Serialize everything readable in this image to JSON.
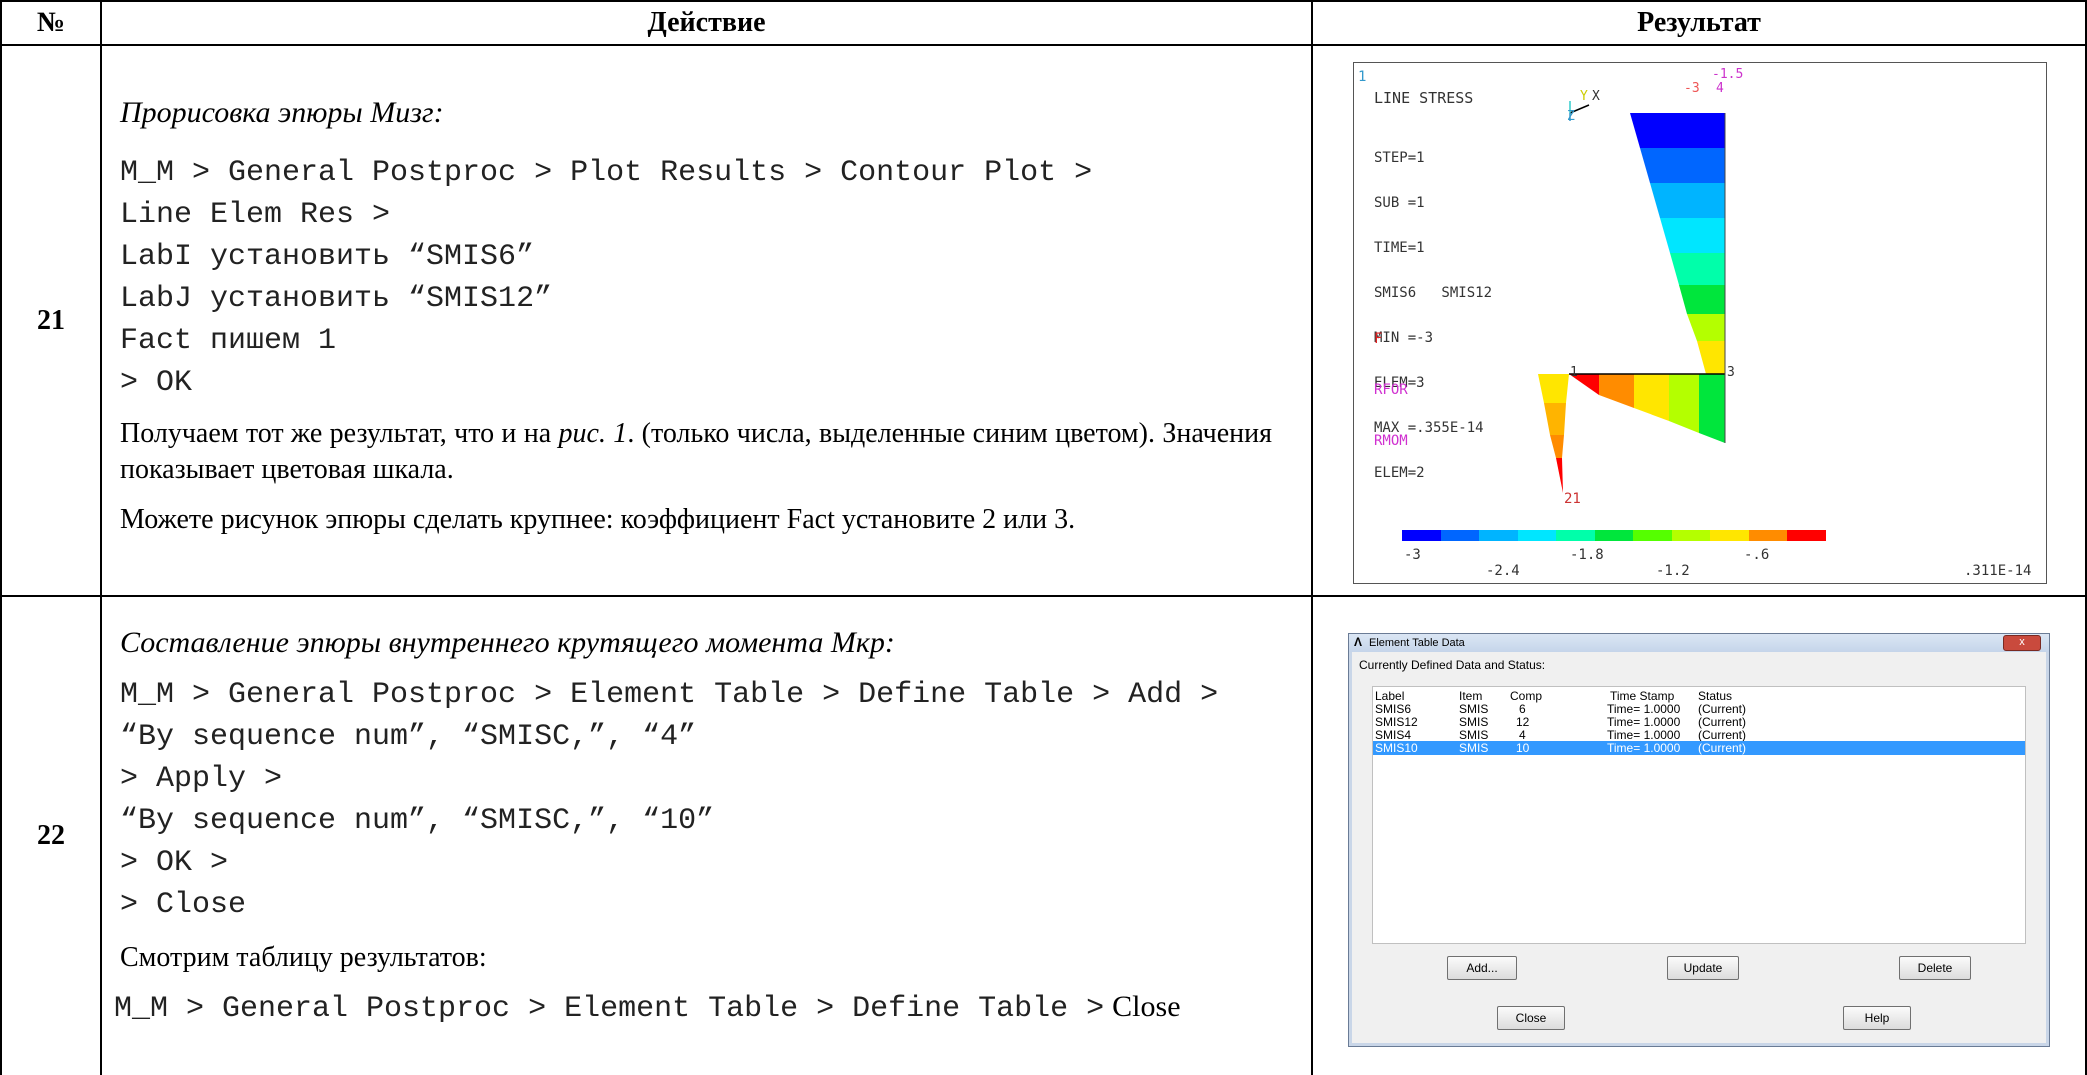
{
  "header": {
    "num": "№",
    "action": "Действие",
    "result": "Результат"
  },
  "row21": {
    "num": "21",
    "title": "Прорисовка эпюры Мизг:",
    "code": [
      "M_M > General Postproc > Plot Results > Contour Plot >",
      "Line Elem Res >",
      "LabI установить “SMIS6”",
      "LabJ установить “SMIS12”",
      "Fact пишем 1",
      "> OK"
    ],
    "p1_pre": "Получаем тот же результат, что и на ",
    "p1_ref": "рис. 1",
    "p1_post": ". (только числа, выделенные синим цветом). Значения показывает цветовая шкала.",
    "p2": "Можете рисунок эпюры сделать крупнее: коэффициент Fact установите 2 или 3.",
    "plot": {
      "corner": "1",
      "title": "LINE STRESS",
      "info": [
        "STEP=1",
        "SUB =1",
        "TIME=1",
        "SMIS6   SMIS12",
        "MIN =-3",
        "ELEM=3",
        "MAX =.355E-14",
        "ELEM=2"
      ],
      "legend": [
        "F",
        "RFOR",
        "RMOM"
      ],
      "axis_y": "Y",
      "axis_x": "X",
      "axis_z": "Z",
      "node1": "1",
      "node2": "2",
      "node3": "3",
      "node4": "4",
      "top_val": "-1.5",
      "top_neg": "-3",
      "bot_label": "21",
      "scale_top": [
        "-3",
        "-1.8",
        "-.6"
      ],
      "scale_bot": [
        "-2.4",
        "-1.2",
        ".311E-14"
      ],
      "colors": [
        "#0000ff",
        "#0066ff",
        "#00b4ff",
        "#00e6ff",
        "#00ffaa",
        "#00e63c",
        "#55ff00",
        "#b4ff00",
        "#ffe600",
        "#ff8c00",
        "#ff0000"
      ]
    }
  },
  "row22": {
    "num": "22",
    "title": "Составление эпюры внутреннего крутящего момента Мкр:",
    "code": [
      "M_M > General Postproc > Element Table > Define Table > Add >",
      "“By sequence num”, “SMISC,”, “4”",
      "> Apply >",
      "“By sequence num”, “SMISC,”, “10”",
      "> OK >",
      "> Close"
    ],
    "p1": "Смотрим таблицу результатов:",
    "code2": "M_M > General Postproc > Element Table > Define Table >",
    "code2_tail": "Close",
    "dialog": {
      "title": "Element Table Data",
      "close": "x",
      "section": "Currently Defined Data and Status:",
      "columns": [
        "Label",
        "Item",
        "Comp",
        "Time Stamp",
        "Status"
      ],
      "rows": [
        [
          "SMIS6",
          "SMIS",
          "6",
          "Time=  1.0000",
          "(Current)"
        ],
        [
          "SMIS12",
          "SMIS",
          "12",
          "Time=  1.0000",
          "(Current)"
        ],
        [
          "SMIS4",
          "SMIS",
          "4",
          "Time=  1.0000",
          "(Current)"
        ],
        [
          "SMIS10",
          "SMIS",
          "10",
          "Time=  1.0000",
          "(Current)"
        ]
      ],
      "buttons": {
        "add": "Add...",
        "update": "Update",
        "delete": "Delete",
        "close": "Close",
        "help": "Help"
      }
    }
  }
}
